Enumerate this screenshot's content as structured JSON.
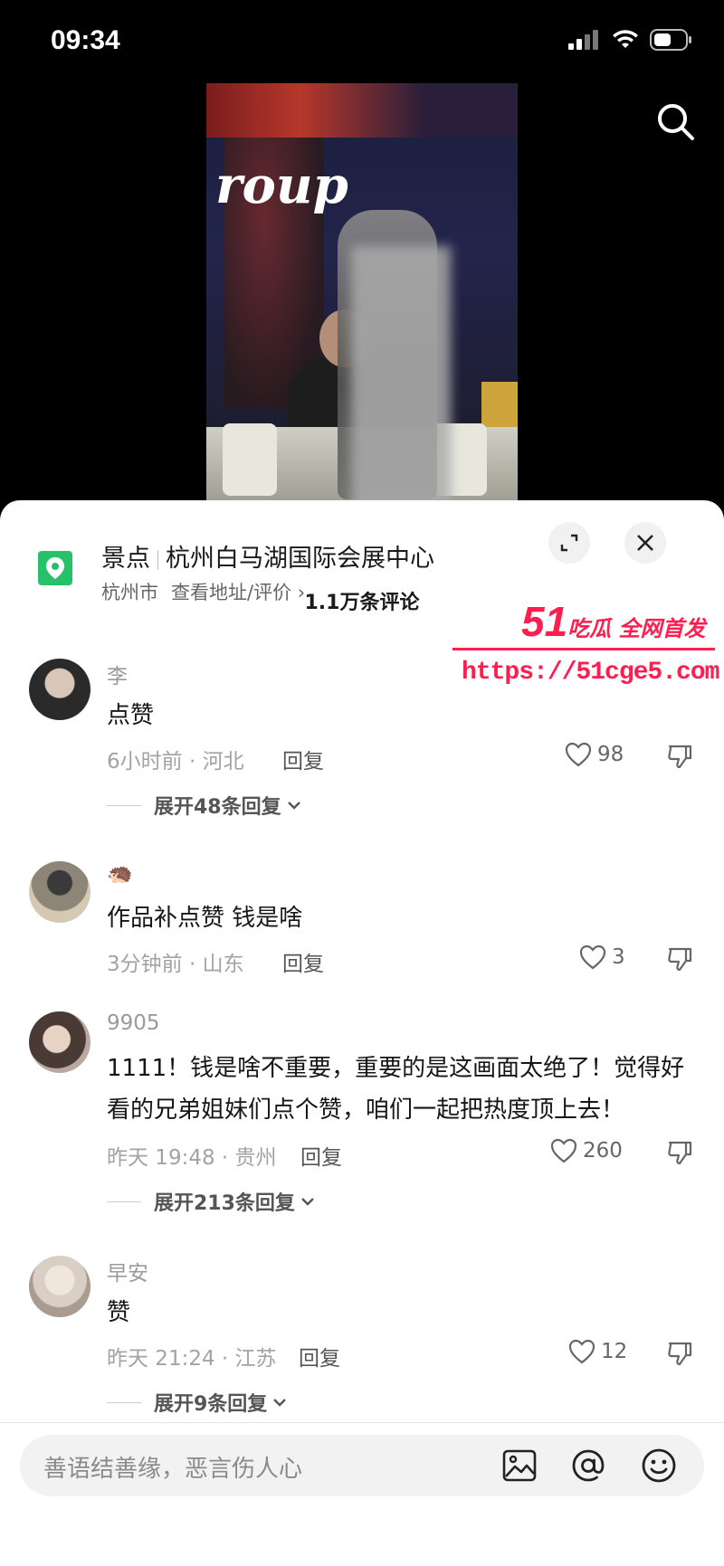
{
  "status_bar": {
    "time": "09:34"
  },
  "location": {
    "category": "景点",
    "name": "杭州白马湖国际会展中心",
    "city": "杭州市",
    "link": "查看地址/评价 ›"
  },
  "comment_count": "1.1万条评论",
  "watermark": {
    "number": "51",
    "text": "吃瓜 全网首发",
    "url": "https://51cge5.com"
  },
  "comments": [
    {
      "user": "李",
      "text": "点赞",
      "time": "6小时前 · 河北",
      "reply": "回复",
      "likes": "98",
      "expand": "展开48条回复"
    },
    {
      "user": "🦔",
      "text": "作品补点赞 钱是啥",
      "time": "3分钟前 · 山东",
      "reply": "回复",
      "likes": "3",
      "expand": ""
    },
    {
      "user": "9905",
      "text": "1111！钱是啥不重要，重要的是这画面太绝了！觉得好看的兄弟姐妹们点个赞，咱们一起把热度顶上去！",
      "time": "昨天 19:48 · 贵州",
      "reply": "回复",
      "likes": "260",
      "expand": "展开213条回复"
    },
    {
      "user": "早安",
      "text": "赞",
      "time": "昨天 21:24 · 江苏",
      "reply": "回复",
      "likes": "12",
      "expand": "展开9条回复"
    }
  ],
  "input": {
    "placeholder": "善语结善缘，恶言伤人心"
  },
  "icons": [
    "signal-icon",
    "wifi-icon",
    "battery-icon",
    "search-icon",
    "location-pin-icon",
    "expand-icon",
    "close-icon",
    "heart-icon",
    "dislike-icon",
    "chevron-down-icon",
    "image-icon",
    "at-icon",
    "emoji-icon"
  ],
  "colors": {
    "accent_green": "#27c16a",
    "watermark_red": "#ff1e4f"
  }
}
